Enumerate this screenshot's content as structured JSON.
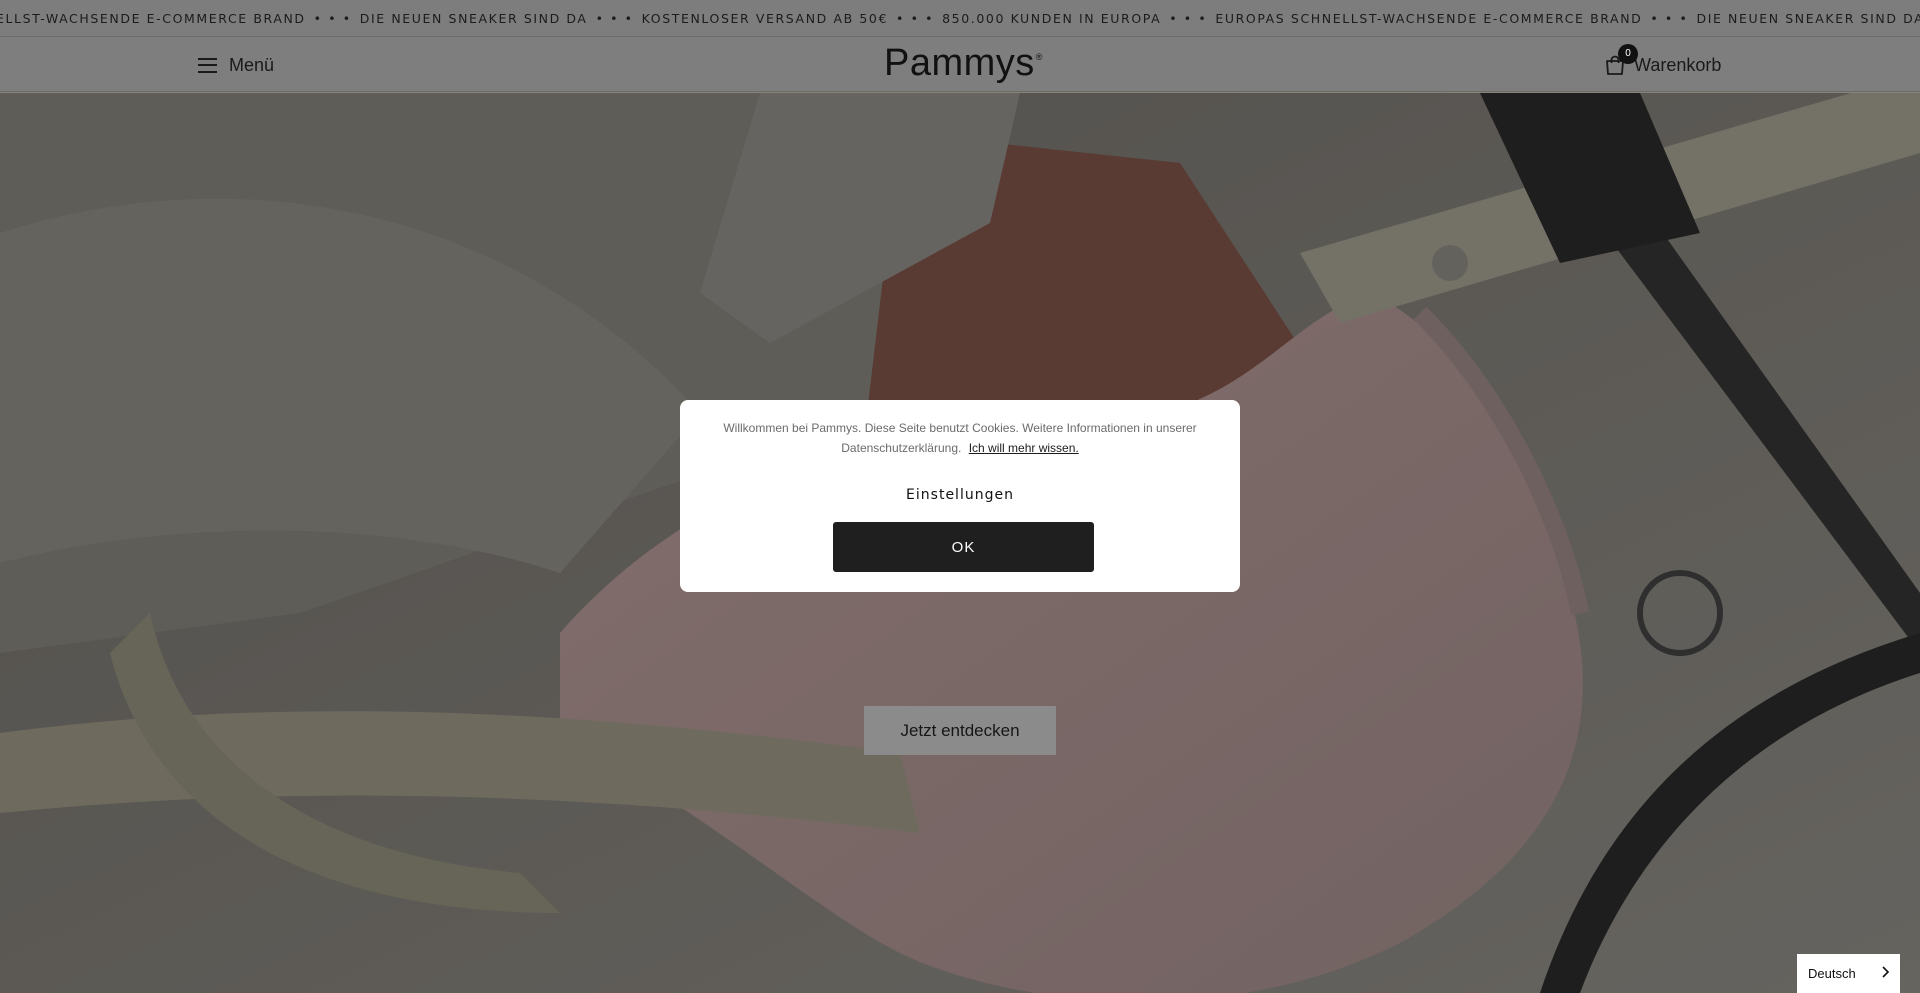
{
  "announcement": {
    "items": [
      "ELLST-WACHSENDE E-COMMERCE BRAND",
      "DIE NEUEN SNEAKER SIND DA",
      "KOSTENLOSER VERSAND AB 50€",
      "850.000 KUNDEN IN EUROPA",
      "EUROPAS SCHNELLST-WACHSENDE E-COMMERCE BRAND",
      "DIE NEUEN SNEAKER SIND DA"
    ],
    "separator": "• • •"
  },
  "header": {
    "menu_label": "Menü",
    "logo": "Pammys",
    "logo_mark": "®",
    "cart_label": "Warenkorb",
    "cart_count": "0"
  },
  "hero": {
    "cta_label": "Jetzt entdecken"
  },
  "cookie_modal": {
    "text": "Willkommen bei Pammys. Diese Seite benutzt Cookies. Weitere Informationen in unserer Datenschutzerklärung.",
    "link_label": "Ich will mehr wissen.",
    "settings_label": "Einstellungen",
    "ok_label": "OK"
  },
  "language": {
    "selected": "Deutsch"
  },
  "icons": {
    "menu": "hamburger-icon",
    "cart": "shopping-bag-icon",
    "language": "chevron-right-icon"
  },
  "colors": {
    "overlay": "#7e7e7e",
    "button_dark": "#1f1f1f",
    "modal_bg": "#ffffff"
  }
}
